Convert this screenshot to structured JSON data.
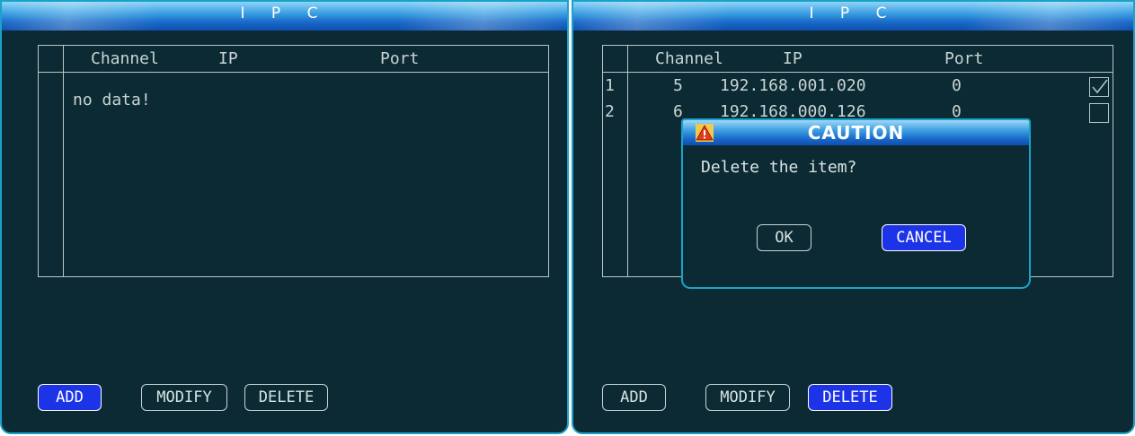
{
  "left": {
    "title": "I P C",
    "headers": {
      "channel": "Channel",
      "ip": "IP",
      "port": "Port"
    },
    "empty_text": "no data!",
    "buttons": {
      "add": "ADD",
      "modify": "MODIFY",
      "delete": "DELETE"
    },
    "active_button": "add"
  },
  "right": {
    "title": "I P C",
    "headers": {
      "channel": "Channel",
      "ip": "IP",
      "port": "Port"
    },
    "rows": [
      {
        "index": "1",
        "channel": "5",
        "ip": "192.168.001.020",
        "port": "0",
        "checked": true
      },
      {
        "index": "2",
        "channel": "6",
        "ip": "192.168.000.126",
        "port": "0",
        "checked": false
      }
    ],
    "buttons": {
      "add": "ADD",
      "modify": "MODIFY",
      "delete": "DELETE"
    },
    "active_button": "delete",
    "dialog": {
      "title": "CAUTION",
      "message": "Delete the item?",
      "ok_label": "OK",
      "cancel_label": "CANCEL",
      "icon": "warning-icon",
      "active_button": "cancel"
    }
  },
  "colors": {
    "background": "#0c2a33",
    "accent_border": "#1aa3c9",
    "active_button": "#1c33e8",
    "text": "#d8e4e4"
  }
}
